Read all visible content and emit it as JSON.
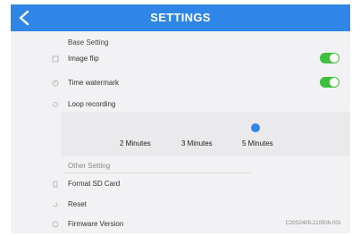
{
  "header": {
    "title": "SETTINGS",
    "back_icon": "chevron-left-icon",
    "accent_color": "#2f86e6"
  },
  "base_section": {
    "title": "Base Setting",
    "items": [
      {
        "label": "Image flip",
        "icon": "flip-icon",
        "toggle": true
      },
      {
        "label": "Time watermark",
        "icon": "clock-icon",
        "toggle": true
      },
      {
        "label": "Loop recording",
        "icon": "loop-icon"
      }
    ]
  },
  "loop_recording": {
    "options": [
      "2 Minutes",
      "3 Minutes",
      "5 Minutes"
    ],
    "selected": "5 Minutes"
  },
  "other_section": {
    "title": "Other Setting",
    "items": [
      {
        "label": "Format SD Card",
        "icon": "sd-card-icon"
      },
      {
        "label": "Reset",
        "icon": "reset-icon"
      },
      {
        "label": "Firmware Version",
        "icon": "info-icon",
        "value": "C20S2409-210506-001"
      }
    ]
  },
  "toggle_on_color": "#3fbf3f"
}
